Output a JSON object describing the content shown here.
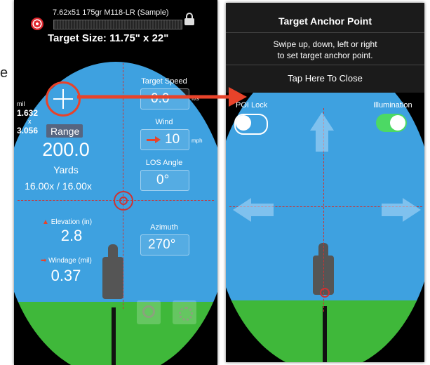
{
  "left_panel": {
    "ammo": "7.62x51 175gr M118-LR (Sample)",
    "target_size": "Target Size: 11.75\" x 22\"",
    "mil_label": "mil",
    "mil_value": "1.632",
    "mil_x": "x",
    "mil_value2": "3.056",
    "range_button": "Range",
    "range_value": "200.0",
    "range_unit": "Yards",
    "zoom": "16.00x / 16.00x",
    "target_speed_label": "Target Speed",
    "target_speed_value": "0.0",
    "target_speed_unit": "ft/s",
    "wind_label": "Wind",
    "wind_value": "10",
    "wind_unit": "mph",
    "los_label": "LOS Angle",
    "los_value": "0°",
    "elevation_label": "Elevation",
    "elevation_unit": "(in)",
    "elevation_value": "2.8",
    "azimuth_label": "Azimuth",
    "azimuth_value": "270°",
    "windage_label": "Windage",
    "windage_unit": "(mil)",
    "windage_value": "0.37"
  },
  "right_panel": {
    "title": "Target Anchor Point",
    "instructions_line1": "Swipe up, down, left or right",
    "instructions_line2": "to set target anchor point.",
    "close": "Tap Here To Close",
    "poi_lock_label": "POI Lock",
    "poi_lock_on": false,
    "illumination_label": "Illumination",
    "illumination_on": true
  },
  "stray_label": "e",
  "colors": {
    "sky": "#3ea1e0",
    "grass": "#3fb83a",
    "reticle": "#cc3333",
    "toggle_on": "#4cd964",
    "arrow": "#e8432a"
  }
}
